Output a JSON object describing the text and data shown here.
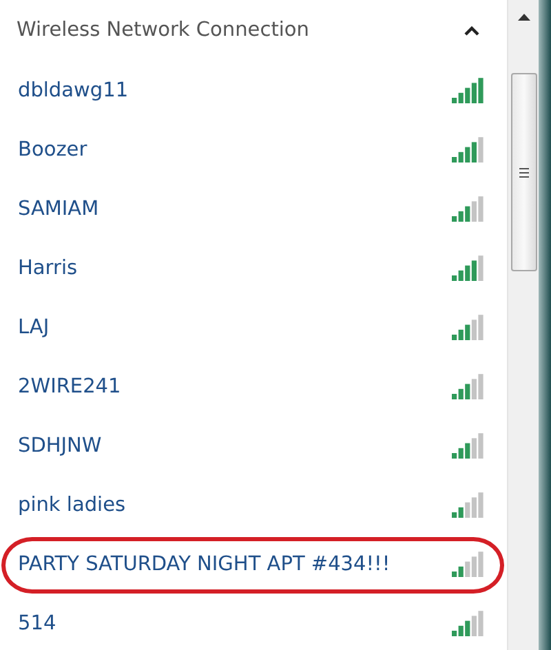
{
  "header": {
    "title": "Wireless Network Connection",
    "expanded": true
  },
  "networks": [
    {
      "name": "dbldawg11",
      "level": 1.0,
      "circled": false
    },
    {
      "name": "Boozer",
      "level": 0.8,
      "circled": false
    },
    {
      "name": "SAMIAM",
      "level": 0.6,
      "circled": false
    },
    {
      "name": "Harris",
      "level": 0.8,
      "circled": false
    },
    {
      "name": "LAJ",
      "level": 0.6,
      "circled": false
    },
    {
      "name": "2WIRE241",
      "level": 0.6,
      "circled": false
    },
    {
      "name": "SDHJNW",
      "level": 0.6,
      "circled": false
    },
    {
      "name": "pink ladies",
      "level": 0.4,
      "circled": false
    },
    {
      "name": "PARTY SATURDAY NIGHT APT #434!!!",
      "level": 0.4,
      "circled": true
    },
    {
      "name": "514",
      "level": 0.6,
      "circled": false
    }
  ]
}
